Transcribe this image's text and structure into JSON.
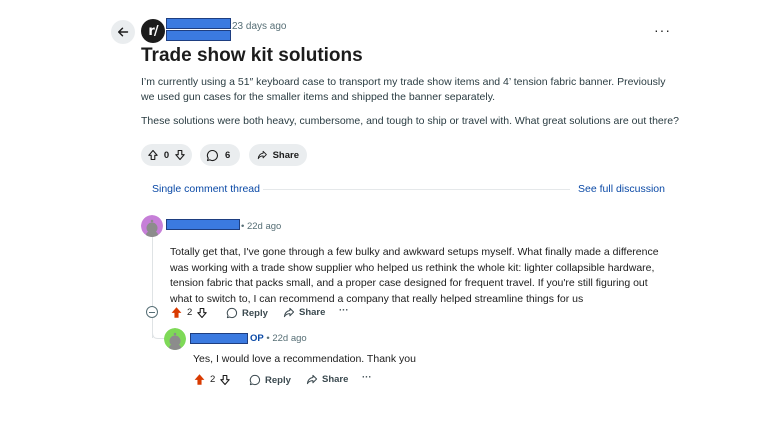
{
  "post": {
    "subreddit_icon": "r/",
    "time": "23 days ago",
    "title": "Trade show kit solutions",
    "body_p1": "I’m currently using a 51″ keyboard case to transport my trade show items and 4’ tension fabric banner. Previously we used gun cases for the smaller items and shipped the banner separately.",
    "body_p2": "These solutions were both heavy, cumbersome, and tough to ship or travel with. What great solutions are out there?",
    "votes": "0",
    "comments": "6",
    "share_label": "Share"
  },
  "thread": {
    "single_label": "Single comment thread",
    "full_label": "See full discussion"
  },
  "comments": [
    {
      "time": "• 22d ago",
      "body": "Totally get that, I've gone through a few bulky and awkward setups myself. What finally made a difference was working with a trade show supplier who helped us rethink the whole kit: lighter collapsible hardware, tension fabric that packs small, and a proper case designed for frequent travel. If you're still figuring out what to switch to, I can recommend a company that really helped streamline things for us",
      "votes": "2",
      "reply_label": "Reply",
      "share_label": "Share",
      "more": "···"
    },
    {
      "op_tag": "OP",
      "time": "• 22d ago",
      "body": "Yes, I would love a recommendation. Thank you",
      "votes": "2",
      "reply_label": "Reply",
      "share_label": "Share",
      "more": "···"
    }
  ],
  "more_icon": "···",
  "colors": {
    "link": "#0a49a6",
    "upvote_active": "#d93a00",
    "redaction": "#3b7ae0",
    "pill_bg": "#eaedef"
  }
}
